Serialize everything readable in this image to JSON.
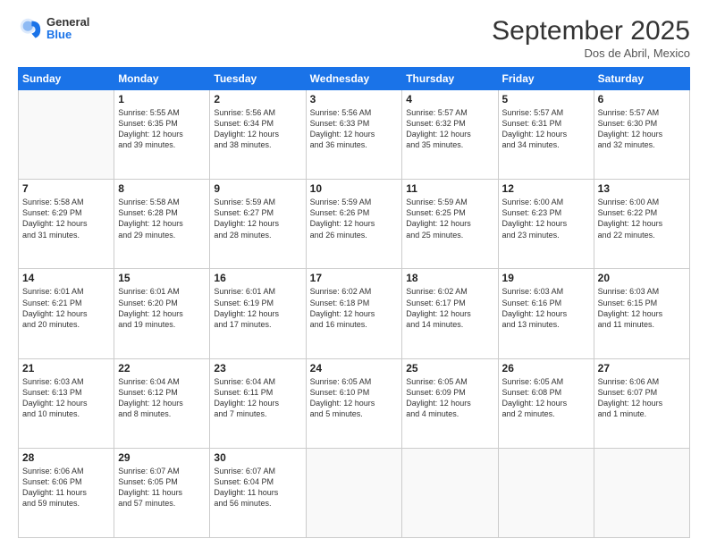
{
  "header": {
    "logo": {
      "general": "General",
      "blue": "Blue"
    },
    "title": "September 2025",
    "subtitle": "Dos de Abril, Mexico"
  },
  "days_of_week": [
    "Sunday",
    "Monday",
    "Tuesday",
    "Wednesday",
    "Thursday",
    "Friday",
    "Saturday"
  ],
  "weeks": [
    [
      {
        "day": "",
        "info": ""
      },
      {
        "day": "1",
        "info": "Sunrise: 5:55 AM\nSunset: 6:35 PM\nDaylight: 12 hours\nand 39 minutes."
      },
      {
        "day": "2",
        "info": "Sunrise: 5:56 AM\nSunset: 6:34 PM\nDaylight: 12 hours\nand 38 minutes."
      },
      {
        "day": "3",
        "info": "Sunrise: 5:56 AM\nSunset: 6:33 PM\nDaylight: 12 hours\nand 36 minutes."
      },
      {
        "day": "4",
        "info": "Sunrise: 5:57 AM\nSunset: 6:32 PM\nDaylight: 12 hours\nand 35 minutes."
      },
      {
        "day": "5",
        "info": "Sunrise: 5:57 AM\nSunset: 6:31 PM\nDaylight: 12 hours\nand 34 minutes."
      },
      {
        "day": "6",
        "info": "Sunrise: 5:57 AM\nSunset: 6:30 PM\nDaylight: 12 hours\nand 32 minutes."
      }
    ],
    [
      {
        "day": "7",
        "info": "Sunrise: 5:58 AM\nSunset: 6:29 PM\nDaylight: 12 hours\nand 31 minutes."
      },
      {
        "day": "8",
        "info": "Sunrise: 5:58 AM\nSunset: 6:28 PM\nDaylight: 12 hours\nand 29 minutes."
      },
      {
        "day": "9",
        "info": "Sunrise: 5:59 AM\nSunset: 6:27 PM\nDaylight: 12 hours\nand 28 minutes."
      },
      {
        "day": "10",
        "info": "Sunrise: 5:59 AM\nSunset: 6:26 PM\nDaylight: 12 hours\nand 26 minutes."
      },
      {
        "day": "11",
        "info": "Sunrise: 5:59 AM\nSunset: 6:25 PM\nDaylight: 12 hours\nand 25 minutes."
      },
      {
        "day": "12",
        "info": "Sunrise: 6:00 AM\nSunset: 6:23 PM\nDaylight: 12 hours\nand 23 minutes."
      },
      {
        "day": "13",
        "info": "Sunrise: 6:00 AM\nSunset: 6:22 PM\nDaylight: 12 hours\nand 22 minutes."
      }
    ],
    [
      {
        "day": "14",
        "info": "Sunrise: 6:01 AM\nSunset: 6:21 PM\nDaylight: 12 hours\nand 20 minutes."
      },
      {
        "day": "15",
        "info": "Sunrise: 6:01 AM\nSunset: 6:20 PM\nDaylight: 12 hours\nand 19 minutes."
      },
      {
        "day": "16",
        "info": "Sunrise: 6:01 AM\nSunset: 6:19 PM\nDaylight: 12 hours\nand 17 minutes."
      },
      {
        "day": "17",
        "info": "Sunrise: 6:02 AM\nSunset: 6:18 PM\nDaylight: 12 hours\nand 16 minutes."
      },
      {
        "day": "18",
        "info": "Sunrise: 6:02 AM\nSunset: 6:17 PM\nDaylight: 12 hours\nand 14 minutes."
      },
      {
        "day": "19",
        "info": "Sunrise: 6:03 AM\nSunset: 6:16 PM\nDaylight: 12 hours\nand 13 minutes."
      },
      {
        "day": "20",
        "info": "Sunrise: 6:03 AM\nSunset: 6:15 PM\nDaylight: 12 hours\nand 11 minutes."
      }
    ],
    [
      {
        "day": "21",
        "info": "Sunrise: 6:03 AM\nSunset: 6:13 PM\nDaylight: 12 hours\nand 10 minutes."
      },
      {
        "day": "22",
        "info": "Sunrise: 6:04 AM\nSunset: 6:12 PM\nDaylight: 12 hours\nand 8 minutes."
      },
      {
        "day": "23",
        "info": "Sunrise: 6:04 AM\nSunset: 6:11 PM\nDaylight: 12 hours\nand 7 minutes."
      },
      {
        "day": "24",
        "info": "Sunrise: 6:05 AM\nSunset: 6:10 PM\nDaylight: 12 hours\nand 5 minutes."
      },
      {
        "day": "25",
        "info": "Sunrise: 6:05 AM\nSunset: 6:09 PM\nDaylight: 12 hours\nand 4 minutes."
      },
      {
        "day": "26",
        "info": "Sunrise: 6:05 AM\nSunset: 6:08 PM\nDaylight: 12 hours\nand 2 minutes."
      },
      {
        "day": "27",
        "info": "Sunrise: 6:06 AM\nSunset: 6:07 PM\nDaylight: 12 hours\nand 1 minute."
      }
    ],
    [
      {
        "day": "28",
        "info": "Sunrise: 6:06 AM\nSunset: 6:06 PM\nDaylight: 11 hours\nand 59 minutes."
      },
      {
        "day": "29",
        "info": "Sunrise: 6:07 AM\nSunset: 6:05 PM\nDaylight: 11 hours\nand 57 minutes."
      },
      {
        "day": "30",
        "info": "Sunrise: 6:07 AM\nSunset: 6:04 PM\nDaylight: 11 hours\nand 56 minutes."
      },
      {
        "day": "",
        "info": ""
      },
      {
        "day": "",
        "info": ""
      },
      {
        "day": "",
        "info": ""
      },
      {
        "day": "",
        "info": ""
      }
    ]
  ]
}
